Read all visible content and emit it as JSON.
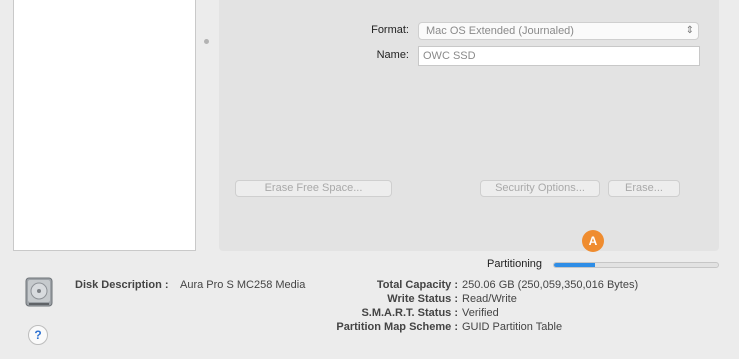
{
  "form": {
    "format_label": "Format:",
    "format_value": "Mac OS Extended (Journaled)",
    "name_label": "Name:",
    "name_value": "OWC SSD"
  },
  "buttons": {
    "erase_free_space": "Erase Free Space...",
    "security_options": "Security Options...",
    "erase": "Erase..."
  },
  "progress": {
    "label": "Partitioning",
    "badge": "A",
    "fraction": 0.25,
    "color": "#2e8de6"
  },
  "info": {
    "disk_description_label": "Disk Description :",
    "disk_description_value": "Aura Pro S MC258 Media",
    "total_capacity_label": "Total Capacity :",
    "total_capacity_value": "250.06 GB (250,059,350,016 Bytes)",
    "write_status_label": "Write Status :",
    "write_status_value": "Read/Write",
    "smart_status_label": "S.M.A.R.T. Status :",
    "smart_status_value": "Verified",
    "partition_map_label": "Partition Map Scheme :",
    "partition_map_value": "GUID Partition Table"
  },
  "help": {
    "symbol": "?"
  },
  "icons": {
    "disk": "hard-disk-icon",
    "help": "help-icon"
  },
  "colors": {
    "accent": "#2e8de6",
    "badge": "#ef8c2f"
  }
}
